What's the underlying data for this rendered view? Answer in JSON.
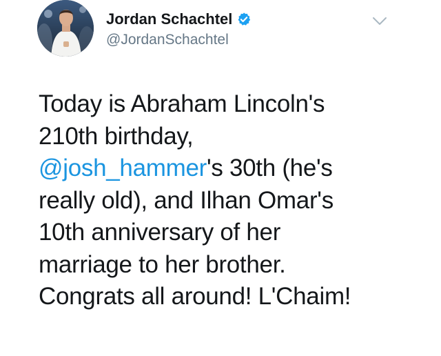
{
  "user": {
    "display_name": "Jordan Schachtel",
    "handle": "@JordanSchachtel",
    "verified": true,
    "avatar_icon": "profile-photo"
  },
  "tweet": {
    "lines": [
      {
        "segments": [
          {
            "text": "Today is Abraham Lincoln's",
            "mention": false
          }
        ]
      },
      {
        "segments": [
          {
            "text": "210th birthday,",
            "mention": false
          }
        ]
      },
      {
        "segments": [
          {
            "text": "@josh_hammer",
            "mention": true
          },
          {
            "text": "'s 30th (he's",
            "mention": false
          }
        ]
      },
      {
        "segments": [
          {
            "text": "really old), and Ilhan Omar's",
            "mention": false
          }
        ]
      },
      {
        "segments": [
          {
            "text": "10th anniversary of her",
            "mention": false
          }
        ]
      },
      {
        "segments": [
          {
            "text": "marriage to her brother.",
            "mention": false
          }
        ]
      },
      {
        "segments": [
          {
            "text": "Congrats all around! L'Chaim!",
            "mention": false
          }
        ]
      }
    ]
  },
  "icons": {
    "verified": "verified-badge-icon",
    "menu": "chevron-down-icon"
  },
  "colors": {
    "link": "#1b95e0",
    "verified": "#1da1f2",
    "handle": "#657786",
    "text": "#14171a",
    "caret": "#aab8c2"
  }
}
